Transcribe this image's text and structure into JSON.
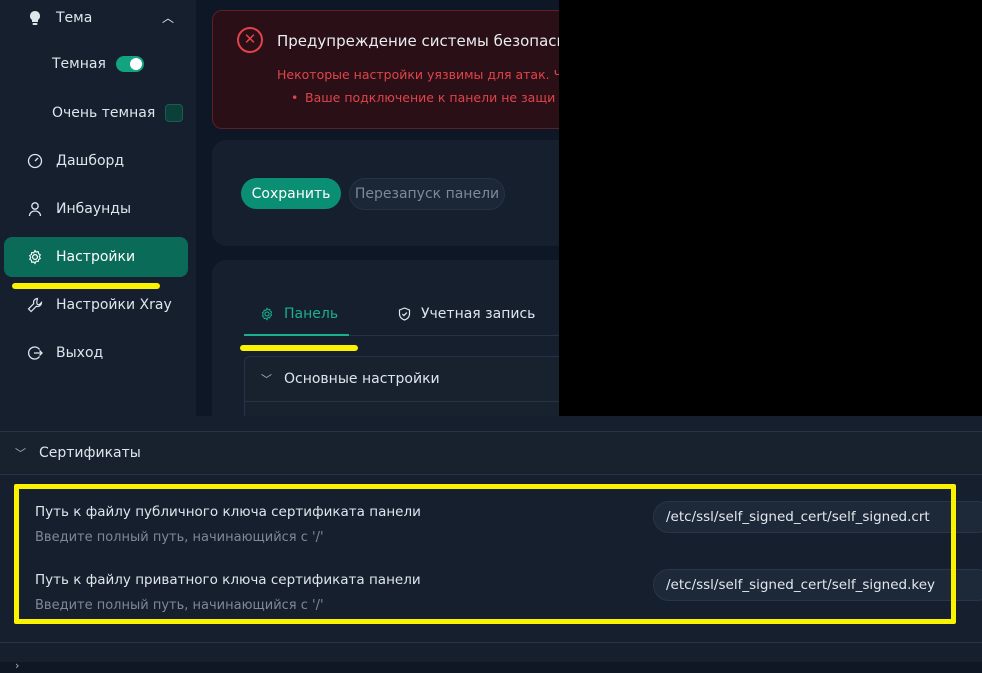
{
  "sidebar": {
    "theme_label": "Тема",
    "dark_label": "Темная",
    "very_dark_label": "Очень темная",
    "items": [
      {
        "label": "Дашборд"
      },
      {
        "label": "Инбаунды"
      },
      {
        "label": "Настройки"
      },
      {
        "label": "Настройки Xray"
      },
      {
        "label": "Выход"
      }
    ]
  },
  "alert": {
    "title": "Предупреждение системы безопаснос",
    "line1": "Некоторые настройки уязвимы для атак. Что",
    "line2": "Ваше подключение к панели не защи"
  },
  "actions": {
    "save": "Сохранить",
    "restart": "Перезапуск панели"
  },
  "tabs": {
    "panel": "Панель",
    "account": "Учетная запись"
  },
  "sections": {
    "basic": "Основные настройки",
    "certs": "Сертификаты"
  },
  "certs": {
    "public": {
      "label": "Путь к файлу публичного ключа сертификата панели",
      "hint": "Введите полный путь, начинающийся с '/'",
      "value": "/etc/ssl/self_signed_cert/self_signed.crt"
    },
    "private": {
      "label": "Путь к файлу приватного ключа сертификата панели",
      "hint": "Введите полный путь, начинающийся с '/'",
      "value": "/etc/ssl/self_signed_cert/self_signed.key"
    }
  },
  "colors": {
    "accent": "#0a8f74",
    "highlight": "#f9f200",
    "danger": "#e0434b"
  }
}
